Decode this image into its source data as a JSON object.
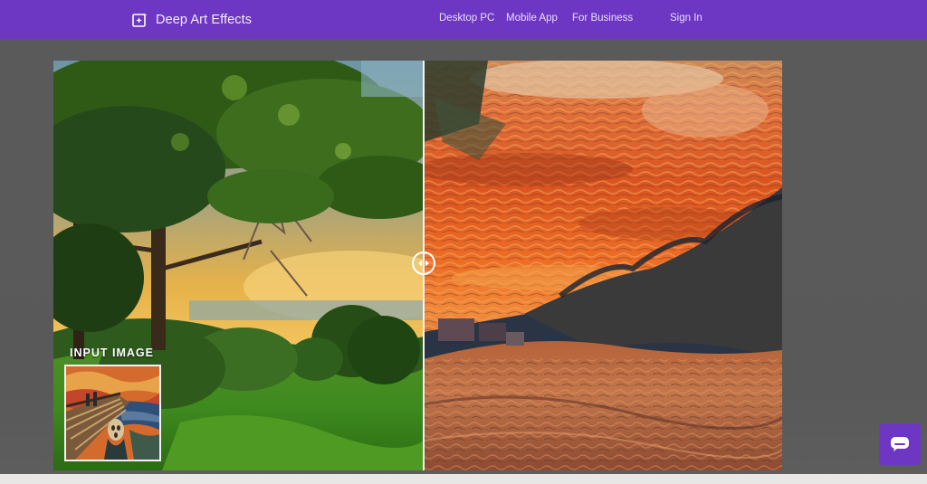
{
  "brand": {
    "name": "Deep Art Effects",
    "icon": "image-sparkle-icon"
  },
  "nav": {
    "links": [
      {
        "label": "Desktop PC"
      },
      {
        "label": "Mobile App"
      },
      {
        "label": "For Business"
      },
      {
        "label": "Sign In"
      }
    ]
  },
  "comparison": {
    "left_side": "photo",
    "right_side": "painted-effect",
    "handle_icon": "drag-arrows-icon"
  },
  "input_image": {
    "label": "INPUT IMAGE"
  },
  "chat": {
    "icon": "chat-bubble-icon"
  },
  "colors": {
    "accent": "#6e37c3",
    "background": "#5b5b5b"
  }
}
